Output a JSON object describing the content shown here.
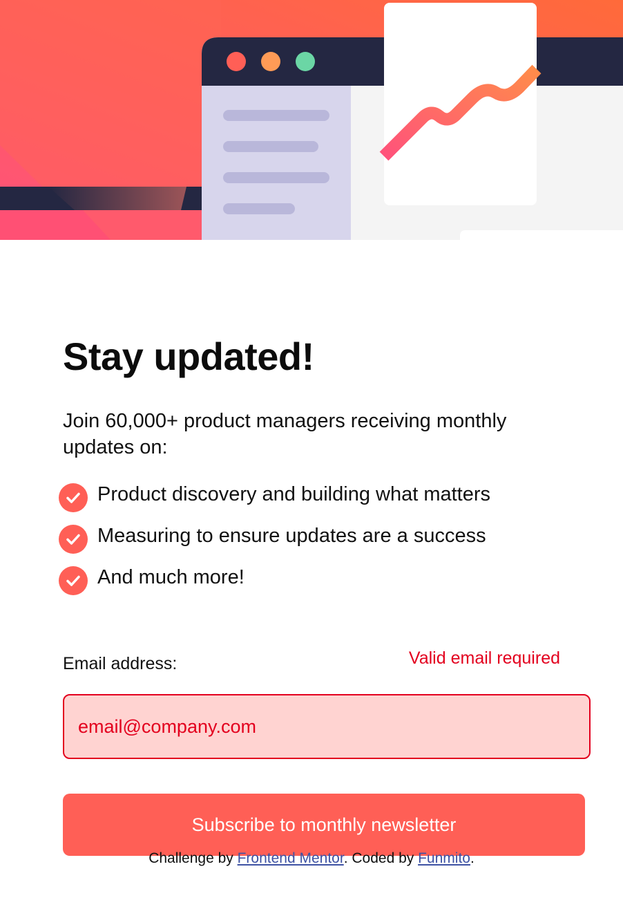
{
  "colors": {
    "accent": "#ff5f56",
    "error": "#e3001e",
    "input_background": "#ffd3d1",
    "link": "#3e52a3",
    "dark_navy": "#242742"
  },
  "hero": {
    "illustration": "dashboard-growth-illustration"
  },
  "main": {
    "title": "Stay updated!",
    "intro": "Join 60,000+ product managers receiving monthly updates on:",
    "features": [
      {
        "icon": "check-circle-icon",
        "text": "Product discovery and building what matters"
      },
      {
        "icon": "check-circle-icon",
        "text": "Measuring to ensure updates are a success"
      },
      {
        "icon": "check-circle-icon",
        "text": "And much more!"
      }
    ]
  },
  "form": {
    "email_label": "Email address:",
    "error_message": "Valid email required",
    "email_value": "",
    "email_placeholder": "email@company.com",
    "submit_label": "Subscribe to monthly newsletter"
  },
  "footer": {
    "prefix": "Challenge by ",
    "challenge_link": "Frontend Mentor",
    "middle": ". Coded by ",
    "author_link": "Funmito",
    "suffix": "."
  }
}
